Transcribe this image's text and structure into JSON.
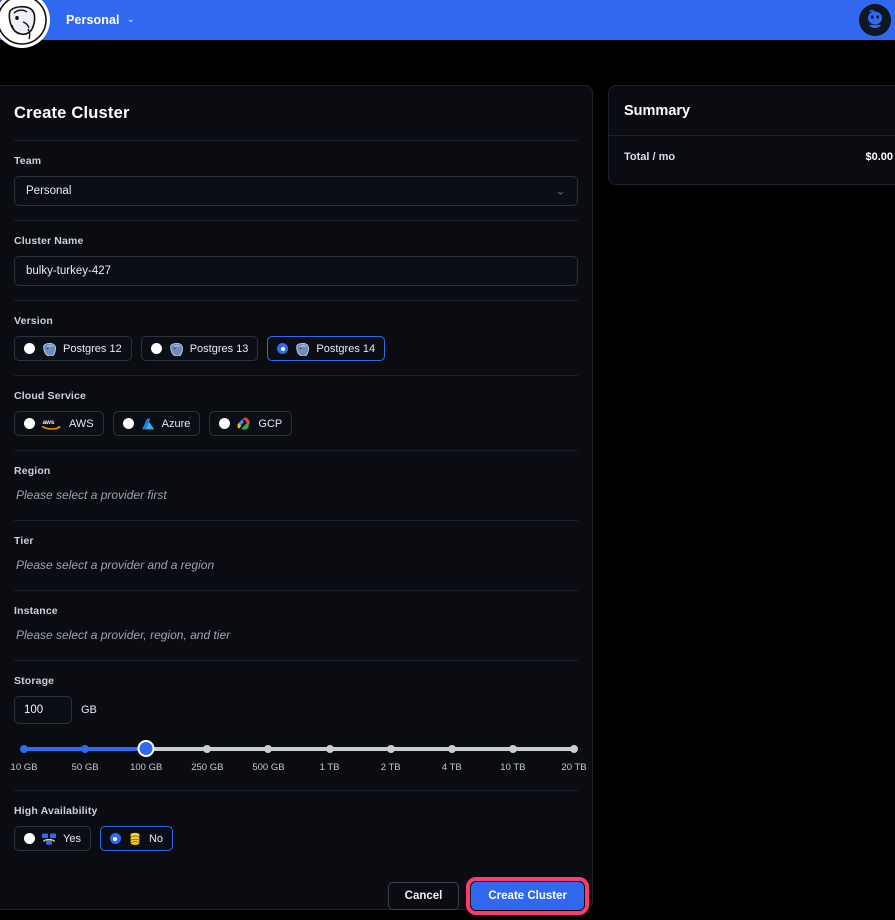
{
  "header": {
    "logo_icon": "postgres-elephant-logo",
    "org_name": "Personal",
    "org_chevron": "⌄",
    "avatar_icon": "user-avatar"
  },
  "form": {
    "title": "Create Cluster",
    "team": {
      "label": "Team",
      "value": "Personal",
      "chevron": "⌄"
    },
    "cluster_name": {
      "label": "Cluster Name",
      "value": "bulky-turkey-427"
    },
    "version": {
      "label": "Version",
      "options": [
        {
          "label": "Postgres 12",
          "icon": "postgres-icon",
          "selected": false
        },
        {
          "label": "Postgres 13",
          "icon": "postgres-icon",
          "selected": false
        },
        {
          "label": "Postgres 14",
          "icon": "postgres-icon",
          "selected": true
        }
      ]
    },
    "cloud_service": {
      "label": "Cloud Service",
      "options": [
        {
          "label": "AWS",
          "icon": "aws-icon",
          "selected": false
        },
        {
          "label": "Azure",
          "icon": "azure-icon",
          "selected": false
        },
        {
          "label": "GCP",
          "icon": "gcp-icon",
          "selected": false
        }
      ]
    },
    "region": {
      "label": "Region",
      "placeholder": "Please select a provider first"
    },
    "tier": {
      "label": "Tier",
      "placeholder": "Please select a provider and a region"
    },
    "instance": {
      "label": "Instance",
      "placeholder": "Please select a provider, region, and tier"
    },
    "storage": {
      "label": "Storage",
      "value": "100",
      "unit": "GB",
      "selected_index": 2,
      "ticks": [
        "10 GB",
        "50 GB",
        "100 GB",
        "250 GB",
        "500 GB",
        "1 TB",
        "2 TB",
        "4 TB",
        "10 TB",
        "20 TB"
      ]
    },
    "high_availability": {
      "label": "High Availability",
      "options": [
        {
          "label": "Yes",
          "icon": "ha-cluster-icon",
          "selected": false
        },
        {
          "label": "No",
          "icon": "single-database-icon",
          "selected": true
        }
      ]
    }
  },
  "summary": {
    "title": "Summary",
    "total_label": "Total / mo",
    "total_value": "$0.00"
  },
  "footer": {
    "cancel_label": "Cancel",
    "create_label": "Create Cluster"
  },
  "colors": {
    "brand_blue": "#3069f0",
    "page_background": "#000000",
    "panel_background": "#0a0c11",
    "highlight_ring": "#fa3c6e"
  }
}
